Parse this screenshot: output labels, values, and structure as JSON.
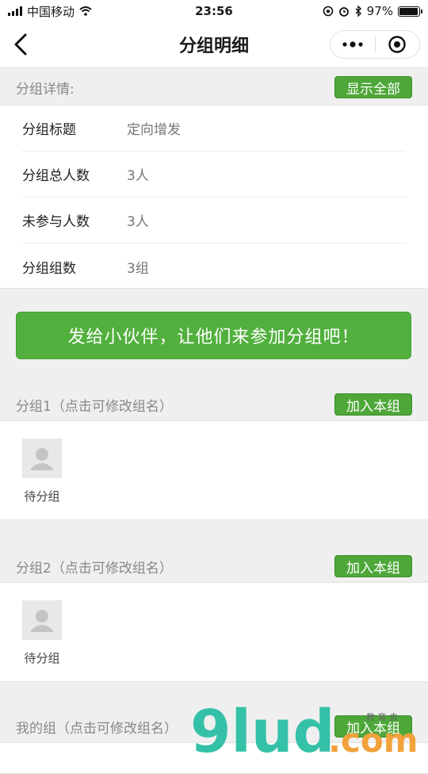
{
  "status_bar": {
    "carrier": "中国移动",
    "time": "23:56",
    "battery": "97%",
    "battery_level": 0.97
  },
  "nav": {
    "title": "分组明细"
  },
  "details": {
    "header": "分组详情:",
    "show_all_label": "显示全部",
    "rows": [
      {
        "label": "分组标题",
        "value": "定向增发"
      },
      {
        "label": "分组总人数",
        "value": "3人"
      },
      {
        "label": "未参与人数",
        "value": "3人"
      },
      {
        "label": "分组组数",
        "value": "3组"
      }
    ]
  },
  "share_button": "发给小伙伴，让他们来参加分组吧！",
  "groups": [
    {
      "title": "分组1（点击可修改组名）",
      "join_label": "加入本组",
      "members": [
        {
          "name": "待分组"
        }
      ]
    },
    {
      "title": "分组2（点击可修改组名）",
      "join_label": "加入本组",
      "members": [
        {
          "name": "待分组"
        }
      ]
    },
    {
      "title": "我的组（点击可修改组名）",
      "join_label": "加入本组",
      "members": []
    }
  ],
  "watermark": {
    "text_main": "9lud",
    "text_suffix": ".com",
    "text_small": "教 育 去"
  },
  "colors": {
    "accent_green": "#4ea739",
    "watermark_teal": "#35c1a8",
    "watermark_orange": "#f2a23a"
  }
}
